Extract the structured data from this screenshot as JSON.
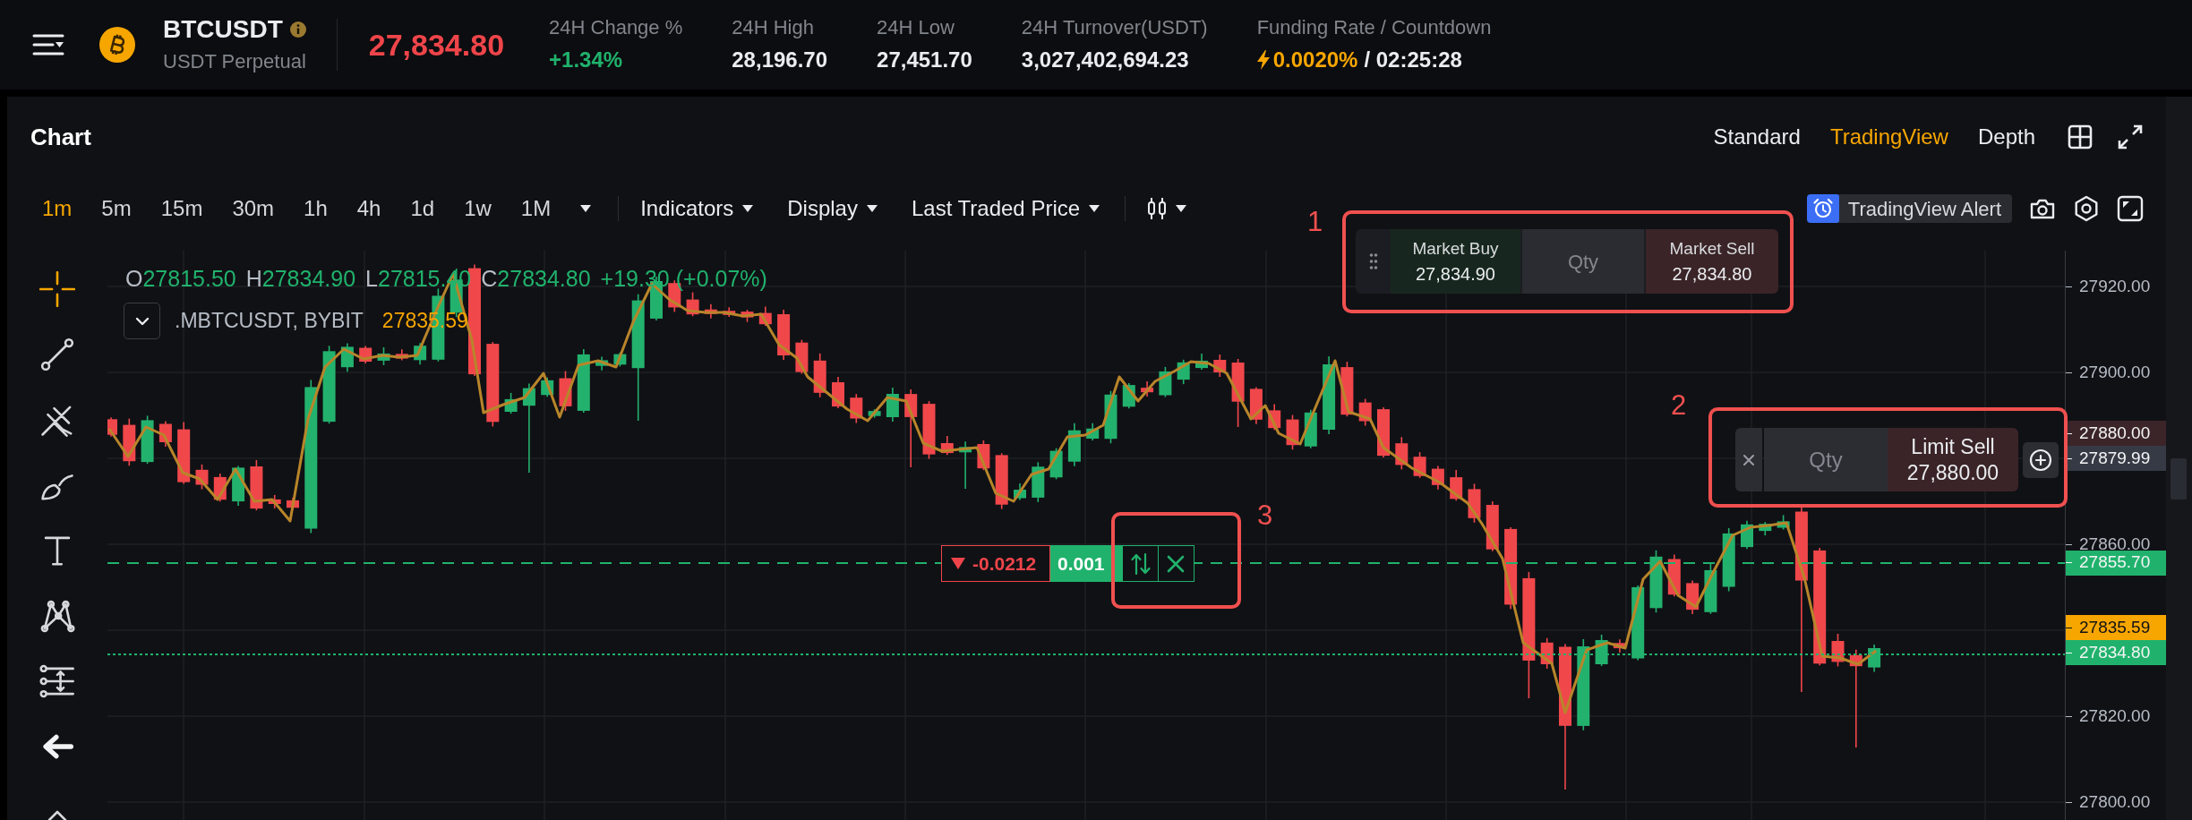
{
  "header": {
    "symbol": "BTCUSDT",
    "contract": "USDT Perpetual",
    "last_price": "27,834.80",
    "stats": [
      {
        "label": "24H Change %",
        "value": "+1.34%",
        "kind": "change"
      },
      {
        "label": "24H High",
        "value": "28,196.70",
        "kind": "plain"
      },
      {
        "label": "24H Low",
        "value": "27,451.70",
        "kind": "plain"
      },
      {
        "label": "24H Turnover(USDT)",
        "value": "3,027,402,694.23",
        "kind": "plain"
      }
    ],
    "funding": {
      "label": "Funding Rate / Countdown",
      "rate": "0.0020%",
      "countdown": "/ 02:25:28"
    }
  },
  "chart": {
    "title": "Chart",
    "views": [
      {
        "label": "Standard",
        "selected": false
      },
      {
        "label": "TradingView",
        "selected": true
      },
      {
        "label": "Depth",
        "selected": false
      }
    ],
    "intervals": [
      {
        "label": "1m",
        "selected": true
      },
      {
        "label": "5m",
        "selected": false
      },
      {
        "label": "15m",
        "selected": false
      },
      {
        "label": "30m",
        "selected": false
      },
      {
        "label": "1h",
        "selected": false
      },
      {
        "label": "4h",
        "selected": false
      },
      {
        "label": "1d",
        "selected": false
      },
      {
        "label": "1w",
        "selected": false
      },
      {
        "label": "1M",
        "selected": false
      }
    ],
    "menus": [
      "Indicators",
      "Display",
      "Last Traded Price"
    ],
    "alert_button": "TradingView Alert",
    "tools": [
      {
        "kind": "crosshair",
        "selected": true
      },
      {
        "kind": "trend_line",
        "selected": false
      },
      {
        "kind": "pitchfork",
        "selected": false
      },
      {
        "kind": "brush",
        "selected": false
      },
      {
        "kind": "text",
        "selected": false
      },
      {
        "kind": "pattern",
        "selected": false
      },
      {
        "kind": "measure",
        "selected": false
      },
      {
        "kind": "collapse",
        "selected": false
      },
      {
        "kind": "eraser",
        "selected": false
      }
    ],
    "legend": {
      "ohlc": [
        {
          "key": "O",
          "value": "27815.50"
        },
        {
          "key": "H",
          "value": "27834.90"
        },
        {
          "key": "L",
          "value": "27815.40"
        },
        {
          "key": "C",
          "value": "27834.80"
        }
      ],
      "change": "+19.30 (+0.07%)",
      "index_symbol": ".MBTCUSDT, BYBIT",
      "index_value": "27835.59"
    },
    "price_axis": [
      {
        "label": "27920.00",
        "kind": "tick"
      },
      {
        "label": "27900.00",
        "kind": "tick"
      },
      {
        "label": "27880.00",
        "kind": "tag",
        "color": "#3b2529"
      },
      {
        "label": "27879.99",
        "kind": "tag",
        "color": "#363a45"
      },
      {
        "label": "27860.00",
        "kind": "tick"
      },
      {
        "label": "27855.70",
        "kind": "tag",
        "color": "#20b26c"
      },
      {
        "label": "27835.59",
        "kind": "tag",
        "color": "#f7a600"
      },
      {
        "label": "27834.80",
        "kind": "tag",
        "color": "#20b26c"
      },
      {
        "label": "27820.00",
        "kind": "tick"
      },
      {
        "label": "27800.00",
        "kind": "tick"
      }
    ]
  },
  "quick_trade": {
    "buy_label": "Market Buy",
    "buy_price": "27,834.90",
    "qty_placeholder": "Qty",
    "sell_label": "Market Sell",
    "sell_price": "27,834.80"
  },
  "limit_order": {
    "qty_placeholder": "Qty",
    "label": "Limit Sell",
    "price": "27,880.00"
  },
  "position": {
    "pnl": "-0.0212",
    "size": "0.001"
  },
  "annotations": [
    {
      "label": "1"
    },
    {
      "label": "2"
    },
    {
      "label": "3"
    }
  ]
}
